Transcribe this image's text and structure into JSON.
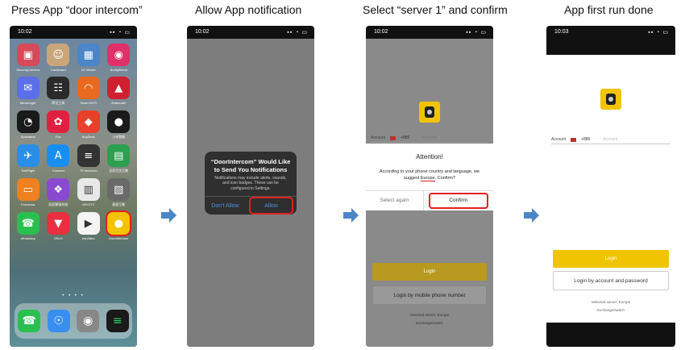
{
  "steps": [
    {
      "title": "Press App “door intercom”"
    },
    {
      "title": "Allow App notification"
    },
    {
      "title": "Select “server 1” and confirm"
    },
    {
      "title": "App first run done"
    }
  ],
  "phone1": {
    "time": "10:02",
    "apps": [
      {
        "label": "SecurityCamera",
        "icon": "app-icon",
        "color": "#d64a5a",
        "glyph": "▣"
      },
      {
        "label": "Cardboard",
        "icon": "app-icon",
        "color": "#c9a67a",
        "glyph": "☺"
      },
      {
        "label": "EZ Viewer",
        "icon": "app-icon",
        "color": "#4a86c8",
        "glyph": "▦"
      },
      {
        "label": "Buddyfriend",
        "icon": "panda-icon",
        "color": "#e0306a",
        "glyph": "◉"
      },
      {
        "label": "Messenger",
        "icon": "messenger-icon",
        "color": "#5a6fe8",
        "glyph": "✉"
      },
      {
        "label": "简记工具",
        "icon": "app-icon",
        "color": "#2a2a2a",
        "glyph": "☷"
      },
      {
        "label": "Smart Wi-Fi",
        "icon": "wifi-icon",
        "color": "#e86a20",
        "glyph": "◠"
      },
      {
        "label": "Avaruudet",
        "icon": "app-icon",
        "color": "#d02030",
        "glyph": "▲"
      },
      {
        "label": "Speedtest",
        "icon": "gauge-icon",
        "color": "#1a1a1a",
        "glyph": "◔"
      },
      {
        "label": "Fax",
        "icon": "flower-icon",
        "color": "#e02040",
        "glyph": "✿"
      },
      {
        "label": "AnyDesk",
        "icon": "diamond-icon",
        "color": "#e8402a",
        "glyph": "◆"
      },
      {
        "label": "小米智能",
        "icon": "app-icon",
        "color": "#1a1a1a",
        "glyph": "●"
      },
      {
        "label": "TestFlight",
        "icon": "plane-icon",
        "color": "#2a8ee8",
        "glyph": "✈"
      },
      {
        "label": "Connect",
        "icon": "appstore-icon",
        "color": "#1a8ef0",
        "glyph": "A"
      },
      {
        "label": "TP Intercom",
        "icon": "app-icon",
        "color": "#333333",
        "glyph": "≡"
      },
      {
        "label": "全家百货互動",
        "icon": "wallet-icon",
        "color": "#2aa050",
        "glyph": "▤"
      },
      {
        "label": "Fennema",
        "icon": "tv-icon",
        "color": "#f08020",
        "glyph": "▭"
      },
      {
        "label": "家庭繁殖系統",
        "icon": "app-icon",
        "color": "#8a4ad0",
        "glyph": "❖"
      },
      {
        "label": "MYCITY",
        "icon": "app-icon",
        "color": "#e8e8e8",
        "glyph": "▥"
      },
      {
        "label": "星星互動",
        "icon": "app-icon",
        "color": "#6a6a6a",
        "glyph": "▧"
      },
      {
        "label": "WhatsApp",
        "icon": "whatsapp-icon",
        "color": "#2ac050",
        "glyph": "☎"
      },
      {
        "label": "CRUX",
        "icon": "location-icon",
        "color": "#e83040",
        "glyph": "▼"
      },
      {
        "label": "myVideo",
        "icon": "app-icon",
        "color": "#f4f4f4",
        "glyph": "▶"
      },
      {
        "label": "DoorIntercom",
        "icon": "door-intercom-icon",
        "color": "#f2c300",
        "glyph": "●"
      }
    ],
    "dock": [
      {
        "icon": "phone-icon",
        "color": "#2ac050",
        "glyph": "☎"
      },
      {
        "icon": "safari-icon",
        "color": "#3a8ef0",
        "glyph": "☉"
      },
      {
        "icon": "camera-icon",
        "color": "#888888",
        "glyph": "◉"
      },
      {
        "icon": "spotify-icon",
        "color": "#1a1a1a",
        "glyph": "≡"
      }
    ],
    "page_dots": "• • • •"
  },
  "phone2": {
    "time": "10:02",
    "dialog_title": "“DoorIntercom” Would Like to Send You Notifications",
    "dialog_message": "Notifications may include alerts, sounds, and icon badges. These can be configured in Settings.",
    "dont_allow": "Don't Allow",
    "allow": "Allow"
  },
  "phone3": {
    "time": "10:02",
    "account_label": "Account",
    "country_code": "+886",
    "account_placeholder": "Account",
    "attention_title": "Attention!",
    "attention_message_1": "According to your phone country and language, we suggest",
    "attention_region": "Europe",
    "attention_message_2": ". Confirm?",
    "select_again": "Select again",
    "confirm": "Confirm",
    "login": "Login",
    "login_phone": "Login by mobile phone number",
    "selected_server": "Selected server: Europe",
    "exchange": "Exchange/switch"
  },
  "phone4": {
    "time": "10:03",
    "account_label": "Account",
    "country_code": "+886",
    "account_placeholder": "Account",
    "login": "Login",
    "login_account": "Login by account and password",
    "selected_server": "Selected server: Europe",
    "exchange": "Exchange/switch"
  },
  "colors": {
    "arrow": "#4a86c8",
    "highlight": "#e02020",
    "brand": "#f2c300"
  }
}
